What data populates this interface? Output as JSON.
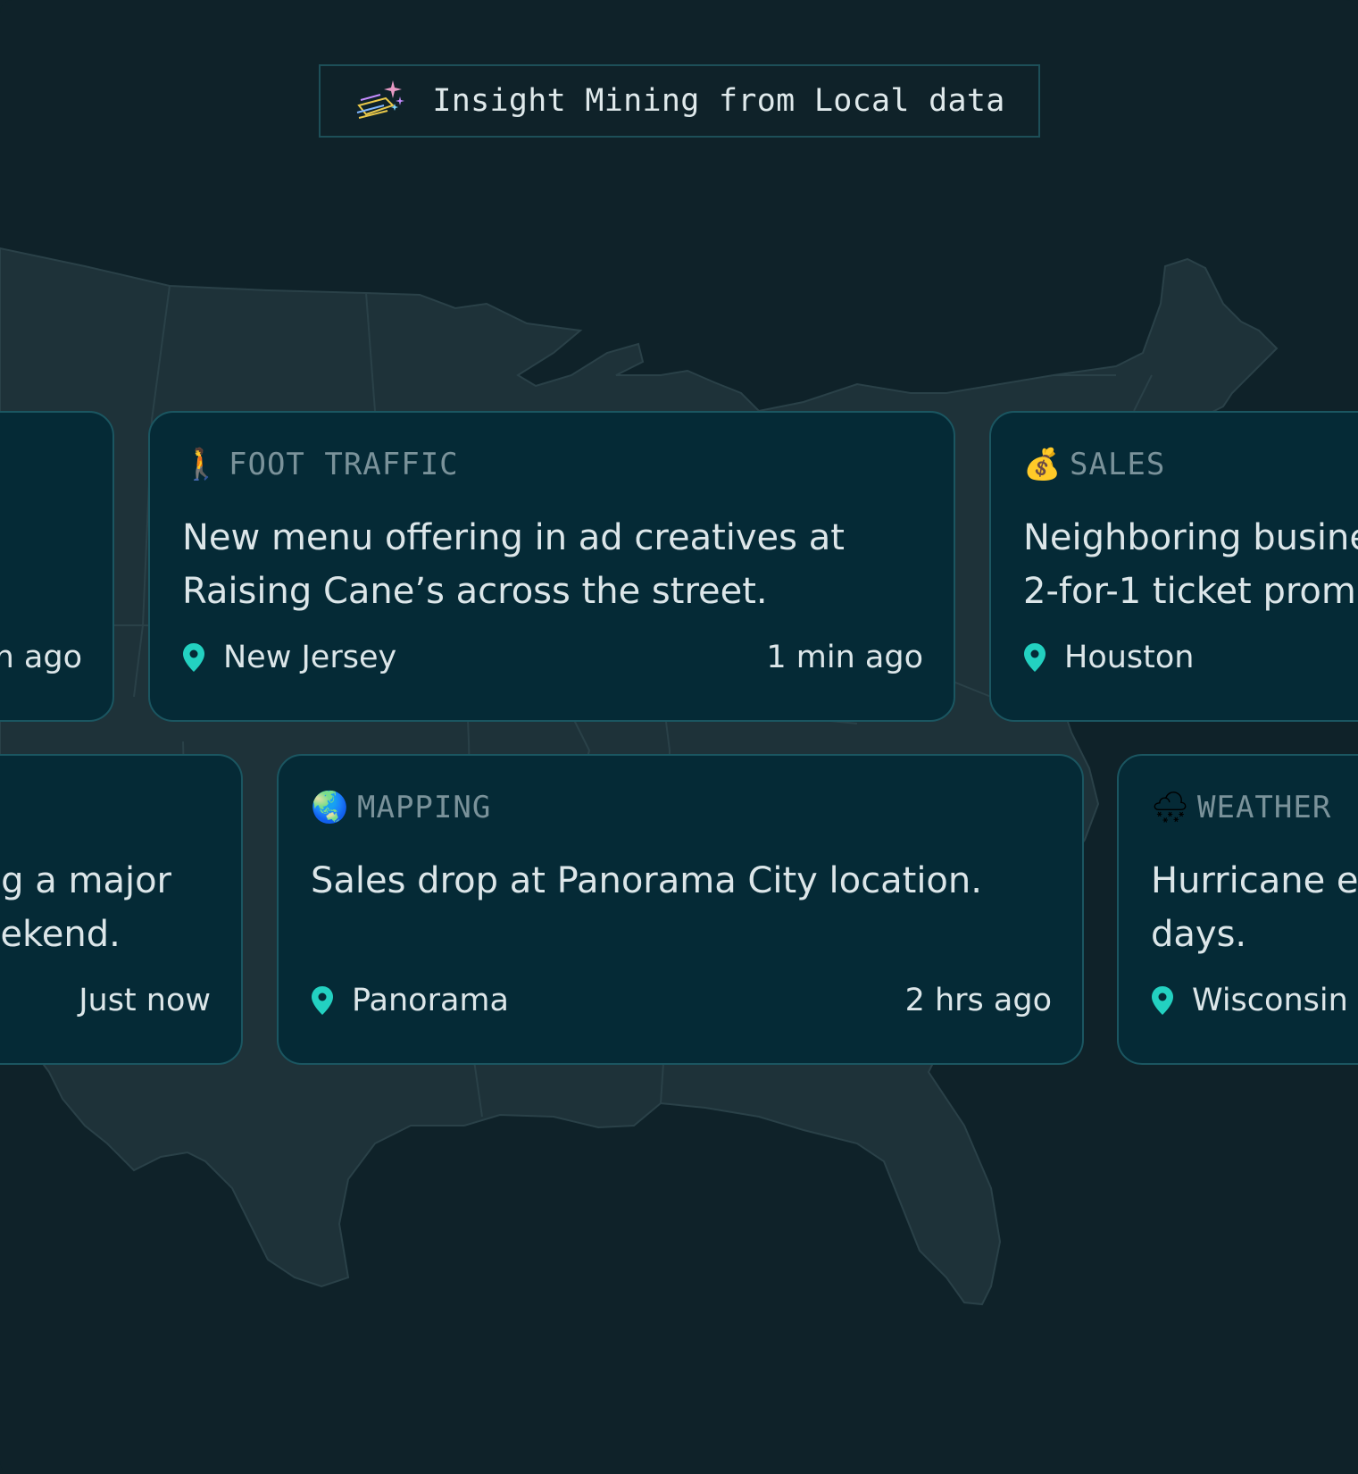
{
  "title": {
    "icon": "shooting-star-sparkles-icon",
    "text": "Insight Mining from Local data"
  },
  "map": {
    "icon": "us-map-silhouette"
  },
  "colors": {
    "background": "#0f2229",
    "map_fill": "#1e3239",
    "card_bg": "#052a36",
    "card_border": "#1b5661",
    "pin": "#23d1c1",
    "category_text": "#7a929a"
  },
  "cards": [
    {
      "category": "",
      "emoji": "",
      "text_lines": [
        "",
        ""
      ],
      "location": "",
      "time": "n ago"
    },
    {
      "category": "FOOT TRAFFIC",
      "emoji": "🚶",
      "emoji_name": "person-walking-icon",
      "text_lines": [
        "New menu offering in ad creatives at",
        "Raising Cane’s across the street."
      ],
      "location": "New Jersey",
      "time": "1 min ago"
    },
    {
      "category": "SALES",
      "emoji": "💰",
      "emoji_name": "money-bag-icon",
      "text_lines": [
        "Neighboring busine",
        "2-for-1 ticket prom"
      ],
      "location": "Houston",
      "time": ""
    },
    {
      "category": "",
      "emoji": "",
      "text_lines": [
        "ng a major",
        "eekend."
      ],
      "location": "",
      "time": "Just now"
    },
    {
      "category": "MAPPING",
      "emoji": "🌏",
      "emoji_name": "globe-icon",
      "text_lines": [
        "Sales drop at Panorama City location.",
        ""
      ],
      "location": "Panorama",
      "time": "2 hrs ago"
    },
    {
      "category": "WEATHER",
      "emoji": "🌨",
      "emoji_name": "cloud-snow-icon",
      "text_lines": [
        "Hurricane ex",
        "days."
      ],
      "location": "Wisconsin",
      "time": ""
    }
  ]
}
